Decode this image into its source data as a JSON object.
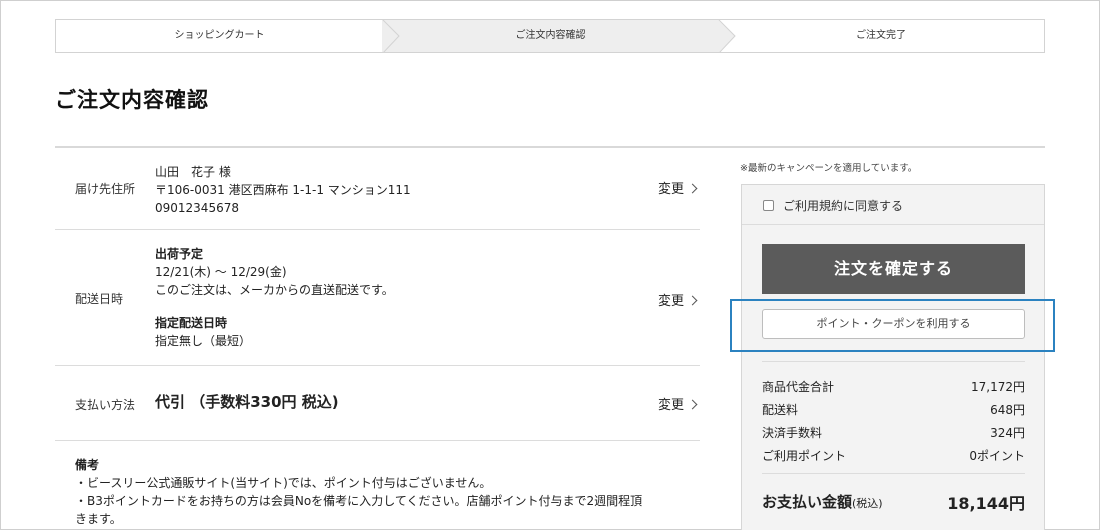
{
  "steps": [
    "ショッピングカート",
    "ご注文内容確認",
    "ご注文完了"
  ],
  "page_title": "ご注文内容確認",
  "delivery_address": {
    "label": "届け先住所",
    "name": "山田　花子 様",
    "address": "〒106-0031 港区西麻布 1-1-1 マンション111",
    "phone": "09012345678",
    "change_label": "変更"
  },
  "delivery_date": {
    "label": "配送日時",
    "ship_heading": "出荷予定",
    "ship_range": "12/21(木) 〜 12/29(金)",
    "ship_note": "このご注文は、メーカからの直送配送です。",
    "specified_heading": "指定配送日時",
    "specified_value": "指定無し（最短）",
    "change_label": "変更"
  },
  "payment": {
    "label": "支払い方法",
    "value": "代引 （手数料330円 税込)",
    "change_label": "変更"
  },
  "remarks": {
    "heading": "備考",
    "line1": "・ビースリー公式通販サイト(当サイト)では、ポイント付与はございません。",
    "line2": "・B3ポイントカードをお持ちの方は会員Noを備考に入力してください。店舗ポイント付与まで2週間程頂",
    "line3": "きます。"
  },
  "summary": {
    "campaign_note": "※最新のキャンペーンを適用しています。",
    "agree_label": "ご利用規約に同意する",
    "agree_checked": false,
    "confirm_button": "注文を確定する",
    "coupon_button": "ポイント・クーポンを利用する",
    "lines": [
      {
        "label": "商品代金合計",
        "value": "17,172円"
      },
      {
        "label": "配送料",
        "value": "648円"
      },
      {
        "label": "決済手数料",
        "value": "324円"
      },
      {
        "label": "ご利用ポイント",
        "value": "0ポイント"
      }
    ],
    "total_label": "お支払い金額",
    "total_suffix": "(税込)",
    "total_value": "18,144円"
  },
  "colors": {
    "confirm_button_bg": "#5b5b5b",
    "highlight_border": "#2b82c0",
    "panel_bg": "#f3f3f3",
    "active_step_bg": "#eeeeee"
  }
}
